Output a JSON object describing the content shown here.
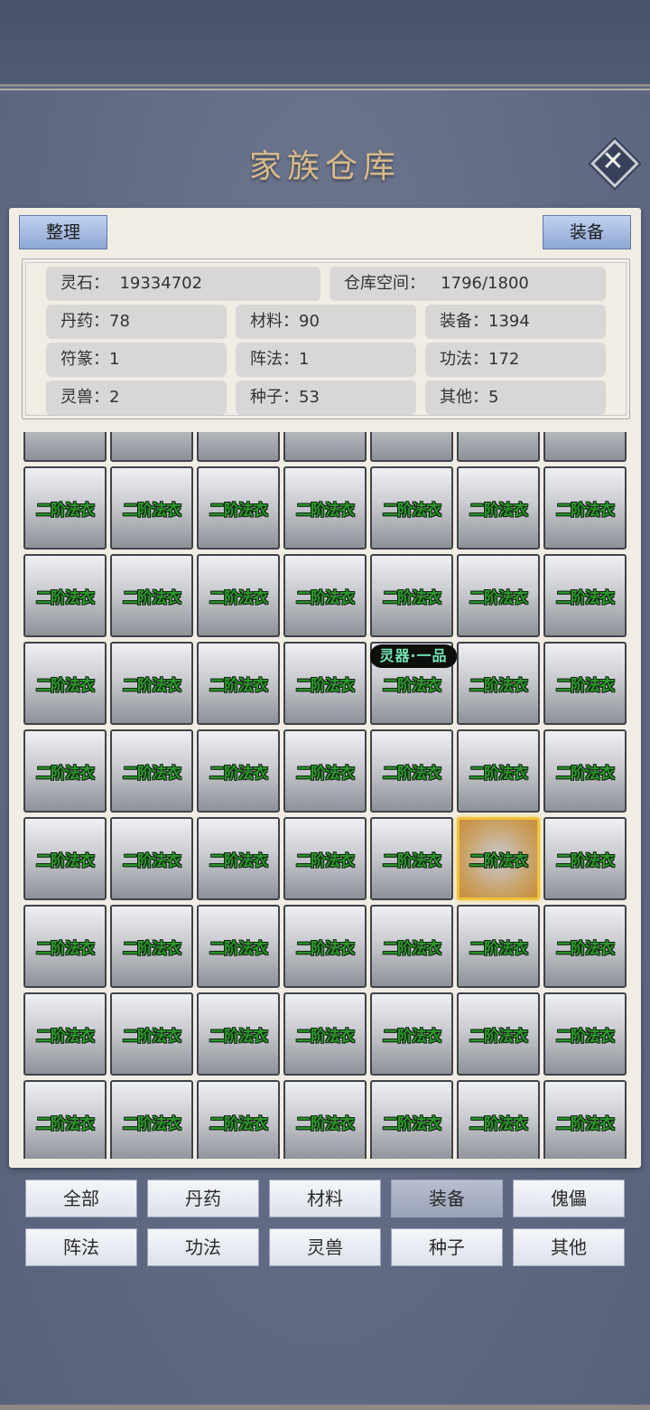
{
  "title": "家族仓库",
  "close_label": "✕",
  "toolbar": {
    "sort_label": "整理",
    "equip_label": "装备"
  },
  "stats": {
    "spirit_stone": "灵石：  19334702",
    "warehouse_space": "仓库空间：   1796/1800",
    "pills": "丹药：78",
    "materials": "材料：90",
    "equipment": "装备：1394",
    "talismans": "符篆：1",
    "formations": "阵法：1",
    "techniques": "功法：172",
    "beasts": "灵兽：2",
    "seeds": "种子：53",
    "others": "其他：5"
  },
  "grid": {
    "item_label": "二阶法衣",
    "columns": 7,
    "visible_rows": 8,
    "selected_row": 4,
    "selected_col": 5,
    "badge_text": "灵器·一品"
  },
  "filters": [
    "全部",
    "丹药",
    "材料",
    "装备",
    "傀儡",
    "阵法",
    "功法",
    "灵兽",
    "种子",
    "其他"
  ],
  "active_filter": "装备"
}
